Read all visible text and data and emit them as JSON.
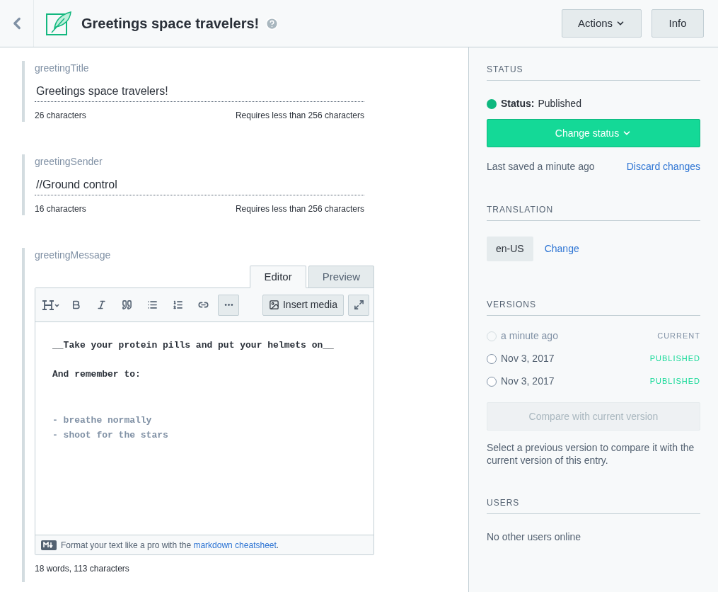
{
  "header": {
    "title": "Greetings space travelers!",
    "buttons": [
      {
        "label": "Actions",
        "kind": "dropdown"
      },
      {
        "label": "Info",
        "kind": "plain"
      }
    ]
  },
  "fields": [
    {
      "name": "greetingTitle",
      "value": "Greetings space travelers!",
      "count": "26 characters",
      "limit": "Requires less than 256 characters"
    },
    {
      "name": "greetingSender",
      "value": "//Ground control",
      "count": "16 characters",
      "limit": "Requires less than 256 characters"
    }
  ],
  "markdown_field": {
    "name": "greetingMessage",
    "tabs": [
      {
        "label": "Editor",
        "selected": true
      },
      {
        "label": "Preview",
        "selected": false
      }
    ],
    "insert_media": "Insert media",
    "blocks": [
      {
        "kind": "strong",
        "lines": [
          "__Take your protein pills and put your helmets on__"
        ]
      },
      {
        "kind": "strong",
        "lines": [
          "And remember to:"
        ]
      },
      {
        "kind": "list",
        "lines": [
          "- breathe normally",
          "- shoot for the stars"
        ]
      }
    ],
    "hint": "Format your text like a pro with the",
    "hint_link": "markdown cheatsheet",
    "hint_end": ".",
    "count": "18 words, 113 characters"
  },
  "sidebar": {
    "status": {
      "heading": "STATUS",
      "label": "Status:",
      "value": "Published",
      "color": "#0eb87f",
      "button": "Change status",
      "saved": "Last saved a minute ago",
      "discard": "Discard changes"
    },
    "translation": {
      "heading": "TRANSLATION",
      "locale": "en-US",
      "change": "Change"
    },
    "versions": {
      "heading": "VERSIONS",
      "items": [
        {
          "label": "a minute ago",
          "tag": "CURRENT",
          "kind": "current",
          "selected": false,
          "disabled": true
        },
        {
          "label": "Nov 3, 2017",
          "tag": "PUBLISHED",
          "kind": "published",
          "selected": false,
          "disabled": false
        },
        {
          "label": "Nov 3, 2017",
          "tag": "PUBLISHED",
          "kind": "published",
          "selected": false,
          "disabled": false
        }
      ],
      "compare": {
        "label": "Compare with current version",
        "disabled": true
      },
      "note": "Select a previous version to compare it with the current version of this entry."
    },
    "users": {
      "heading": "USERS",
      "text": "No other users online"
    }
  }
}
